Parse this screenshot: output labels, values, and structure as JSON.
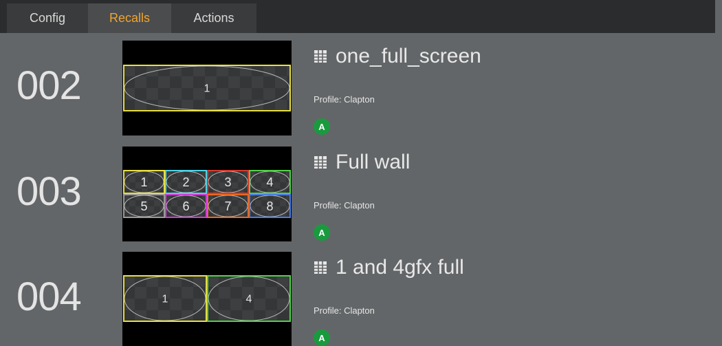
{
  "tabs": [
    {
      "label": "Config",
      "active": false
    },
    {
      "label": "Recalls",
      "active": true
    },
    {
      "label": "Actions",
      "active": false
    }
  ],
  "colors": {
    "accent": "#f0a431",
    "badge": "#1a9a3e",
    "background": "#636668",
    "tabbar": "#2b2c2d"
  },
  "recalls": [
    {
      "number": "002",
      "title": "one_full_screen",
      "title_icon": "grid-icon",
      "profile": "Profile: Clapton",
      "badge": "A",
      "thumbnail_layout": "single",
      "windows": [
        {
          "label": "1",
          "border": "#e8e040"
        }
      ]
    },
    {
      "number": "003",
      "title": "Full wall",
      "title_icon": "grid-icon",
      "profile": "Profile: Clapton",
      "badge": "A",
      "thumbnail_layout": "grid-4x2",
      "windows": [
        {
          "label": "1",
          "border": "#e8e040"
        },
        {
          "label": "2",
          "border": "#4dd4e8"
        },
        {
          "label": "3",
          "border": "#d83a2e"
        },
        {
          "label": "4",
          "border": "#52d14a"
        },
        {
          "label": "5",
          "border": "#9a9a9a"
        },
        {
          "label": "6",
          "border": "#d23ad8"
        },
        {
          "label": "7",
          "border": "#ec6a1e"
        },
        {
          "label": "8",
          "border": "#4a7be8"
        }
      ]
    },
    {
      "number": "004",
      "title": "1 and 4gfx full",
      "title_icon": "grid-icon",
      "profile": "Profile: Clapton",
      "badge": "A",
      "thumbnail_layout": "split-2",
      "windows": [
        {
          "label": "1",
          "border": "#e8e040"
        },
        {
          "label": "4",
          "border": "#52d14a"
        }
      ]
    }
  ]
}
